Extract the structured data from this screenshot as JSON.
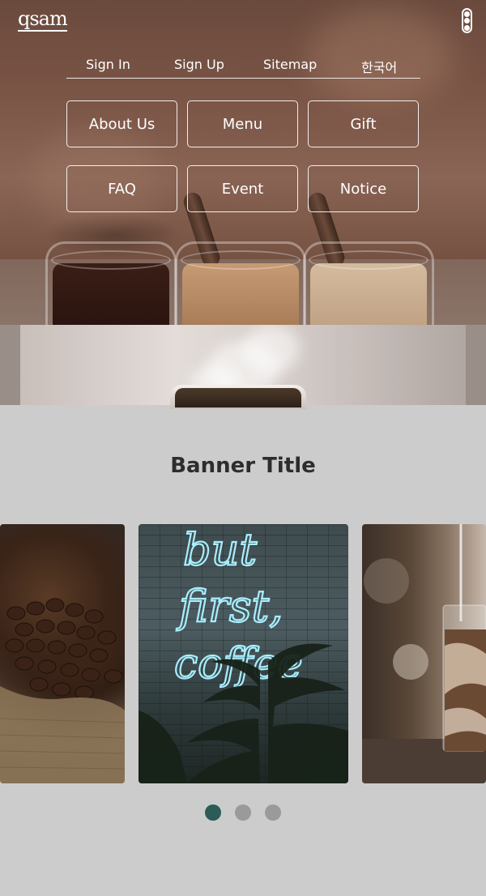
{
  "header": {
    "logo": "qsam",
    "menu_icon": "kebab-menu-icon"
  },
  "top_nav": [
    {
      "label": "Sign In"
    },
    {
      "label": "Sign Up"
    },
    {
      "label": "Sitemap"
    },
    {
      "label": "한국어"
    }
  ],
  "menu_buttons": [
    {
      "label": "About Us"
    },
    {
      "label": "Menu"
    },
    {
      "label": "Gift"
    },
    {
      "label": "FAQ"
    },
    {
      "label": "Event"
    },
    {
      "label": "Notice"
    }
  ],
  "banner": {
    "title": "Banner Title",
    "cards": [
      {
        "image": "coffee-beans-sack"
      },
      {
        "image": "neon-sign-but-first-coffee",
        "neon_text": [
          "but",
          "first,",
          "coffee"
        ]
      },
      {
        "image": "iced-coffee-glass"
      }
    ],
    "pagination": {
      "total": 3,
      "active": 1
    }
  },
  "colors": {
    "active_dot": "#2b5c57",
    "inactive_dot": "#9a9a9a",
    "section_bg": "#cccccc",
    "neon": "#a8eeff"
  }
}
